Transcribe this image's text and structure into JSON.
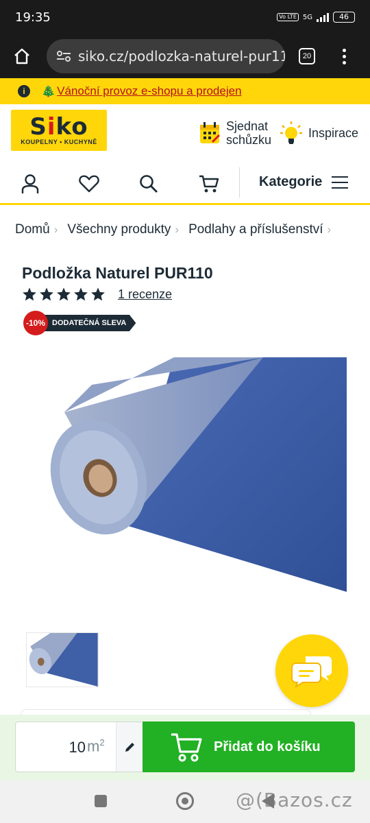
{
  "status_bar": {
    "time": "19:35",
    "network": "5G",
    "volte": "Vo LTE",
    "battery": "46"
  },
  "browser": {
    "url": "siko.cz/podlozka-naturel-pur11",
    "tab_count": "20"
  },
  "promo": {
    "tree": "🎄",
    "text": "Vánoční provoz e-shopu a prodejen"
  },
  "logo": {
    "name_start": "S",
    "name_i": "i",
    "name_end": "ko",
    "sub": "KOUPELNY • KUCHYNĚ"
  },
  "header": {
    "meet_line1": "Sjednat",
    "meet_line2": "schůzku",
    "inspiration": "Inspirace"
  },
  "nav": {
    "categories": "Kategorie"
  },
  "breadcrumb": [
    "Domů",
    "Všechny produkty",
    "Podlahy a příslušenství"
  ],
  "product": {
    "title": "Podložka Naturel PUR110",
    "rating": 5,
    "reviews": "1 recenze",
    "discount": "-10%",
    "discount_label": "DODATEČNÁ SLEVA"
  },
  "buy": {
    "quantity": "10",
    "unit": "m",
    "unit_sup": "2",
    "add_to_cart": "Přidat do košíku"
  },
  "watermark": "@(Bazos.cz",
  "colors": {
    "brand_yellow": "#ffd60a",
    "brand_dark": "#1d2b36",
    "discount_red": "#d41c1c",
    "cart_green": "#22b024",
    "product_blue": "#3f5fa6"
  }
}
